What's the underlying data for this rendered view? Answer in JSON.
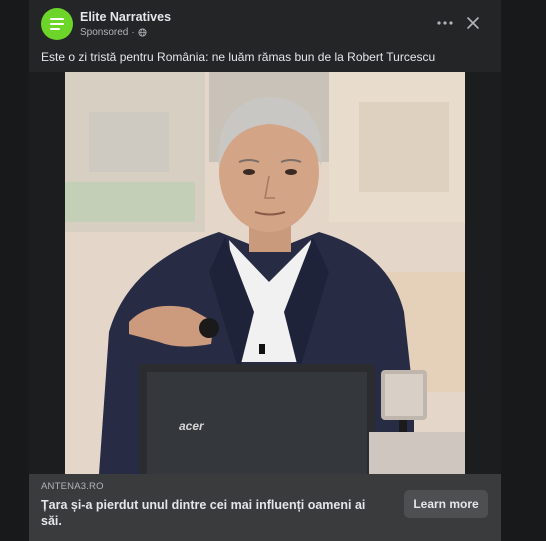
{
  "post": {
    "author": "Elite Narratives",
    "sponsored_label": "Sponsored",
    "caption": "Este o zi tristă pentru România: ne luăm rămas bun de la Robert Turcescu",
    "laptop_brand": "acer"
  },
  "link_preview": {
    "domain": "ANTENA3.RO",
    "title": "Țara și-a pierdut unul dintre cei mai influenți oameni ai săi.",
    "cta_label": "Learn more"
  },
  "colors": {
    "avatar": "#6dd42a",
    "card_bg": "#242526",
    "link_bar_bg": "#3a3b3c",
    "cta_bg": "#4e4f50"
  },
  "icons": {
    "avatar": "menu-lines-icon",
    "privacy": "globe-icon",
    "more": "more-dots-icon",
    "close": "close-icon"
  }
}
